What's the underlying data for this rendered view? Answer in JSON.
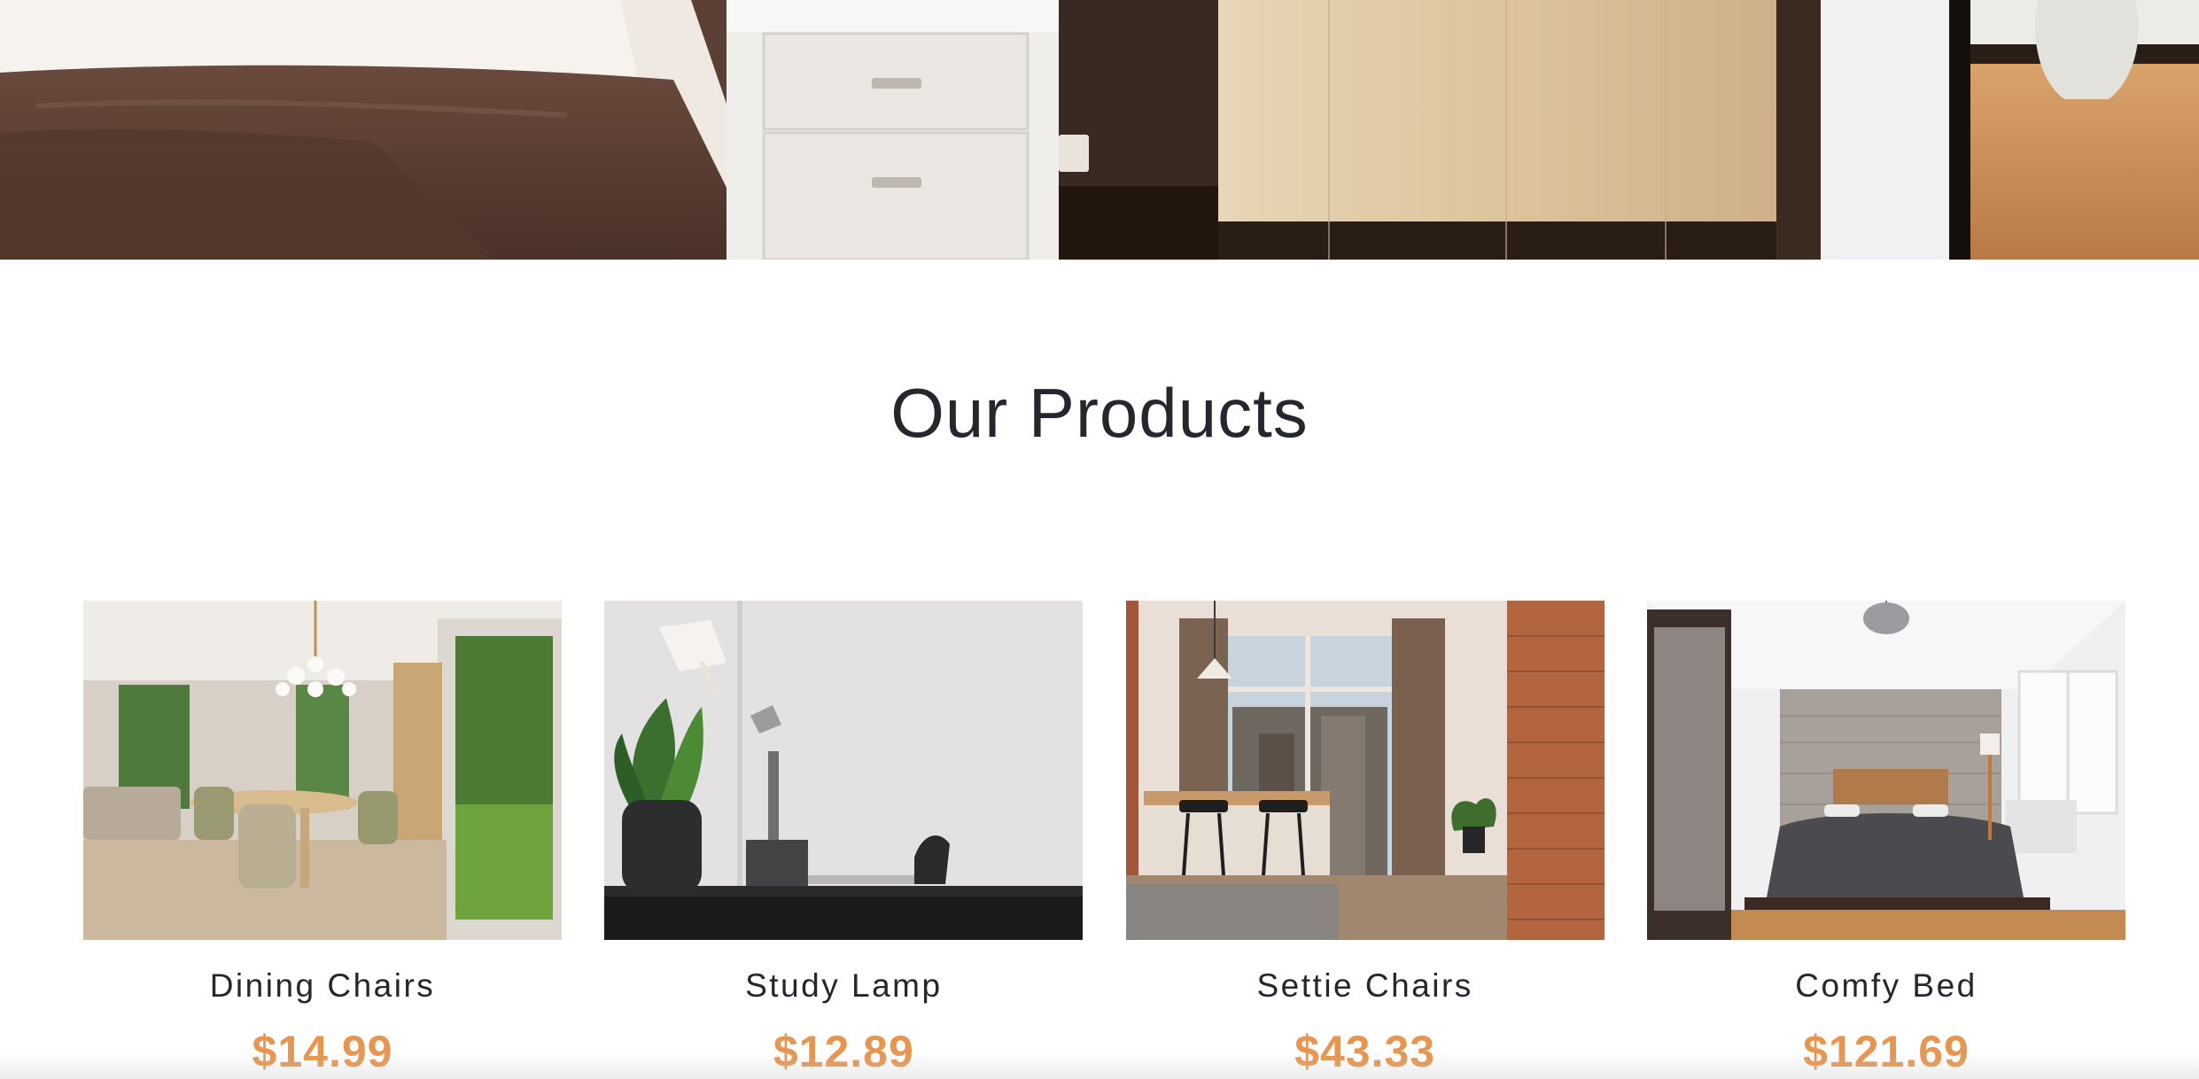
{
  "hero": {
    "image_icon": "bedroom-photo"
  },
  "section": {
    "title": "Our Products"
  },
  "products": [
    {
      "name": "Dining Chairs",
      "price": "$14.99",
      "image_icon": "dining-room-photo"
    },
    {
      "name": "Study Lamp",
      "price": "$12.89",
      "image_icon": "desk-lamp-photo"
    },
    {
      "name": "Settie Chairs",
      "price": "$43.33",
      "image_icon": "apartment-kitchen-photo"
    },
    {
      "name": "Comfy Bed",
      "price": "$121.69",
      "image_icon": "bedroom-bed-photo"
    }
  ],
  "colors": {
    "title": "#24272d",
    "price_accent": "#e7954f",
    "background": "#ffffff"
  }
}
